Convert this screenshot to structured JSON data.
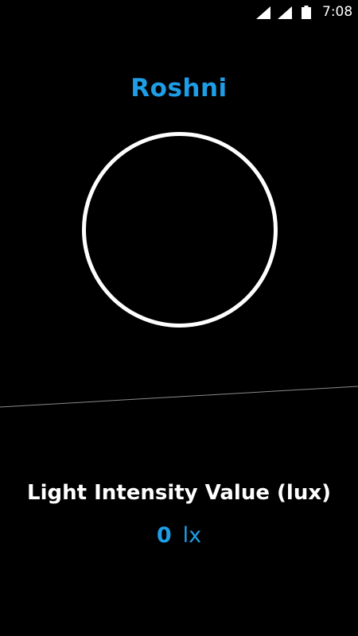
{
  "status_bar": {
    "time": "7:08",
    "icons": [
      "signal-icon",
      "signal-icon",
      "battery-icon"
    ]
  },
  "app": {
    "title": "Roshni"
  },
  "sensor": {
    "label": "Light Intensity Value (lux)",
    "value": "0",
    "unit": "lx"
  },
  "colors": {
    "accent": "#1e9ee6",
    "background": "#000000",
    "text": "#ffffff"
  }
}
